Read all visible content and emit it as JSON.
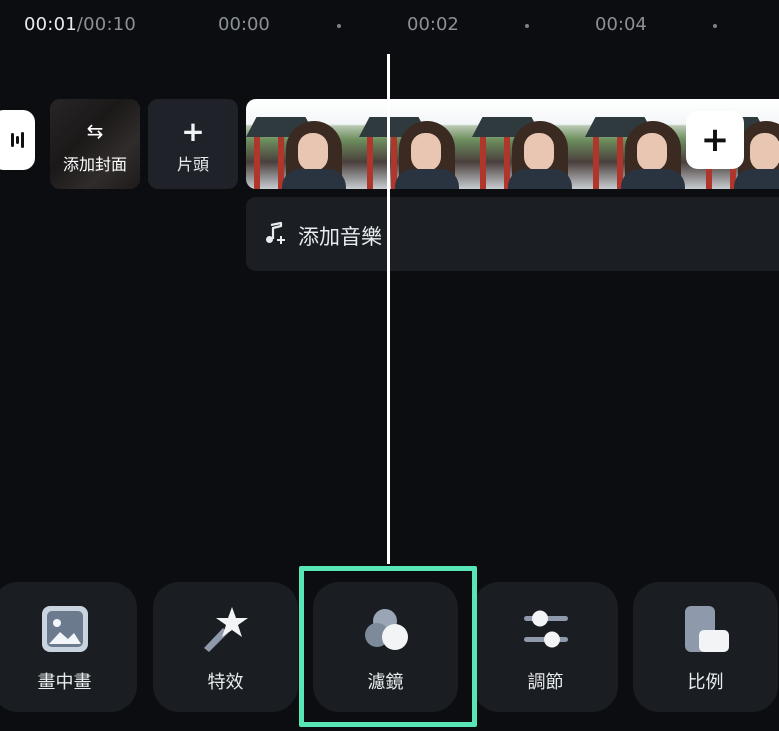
{
  "ruler": {
    "current_time": "00:01",
    "total_time": "/00:10",
    "ticks": [
      "00:00",
      "00:02",
      "00:04"
    ]
  },
  "timeline": {
    "cover_label": "添加封面",
    "intro_label": "片頭",
    "music_label": "添加音樂"
  },
  "toolbar": {
    "items": [
      {
        "label": "畫中畫",
        "icon": "picture-in-picture-icon"
      },
      {
        "label": "特效",
        "icon": "effects-star-icon"
      },
      {
        "label": "濾鏡",
        "icon": "filter-circles-icon"
      },
      {
        "label": "調節",
        "icon": "adjust-sliders-icon"
      },
      {
        "label": "比例",
        "icon": "aspect-ratio-icon"
      }
    ],
    "highlighted": "濾鏡"
  },
  "colors": {
    "background": "#0b0d10",
    "tile": "#1a1d22",
    "highlight": "#58e6b7"
  }
}
